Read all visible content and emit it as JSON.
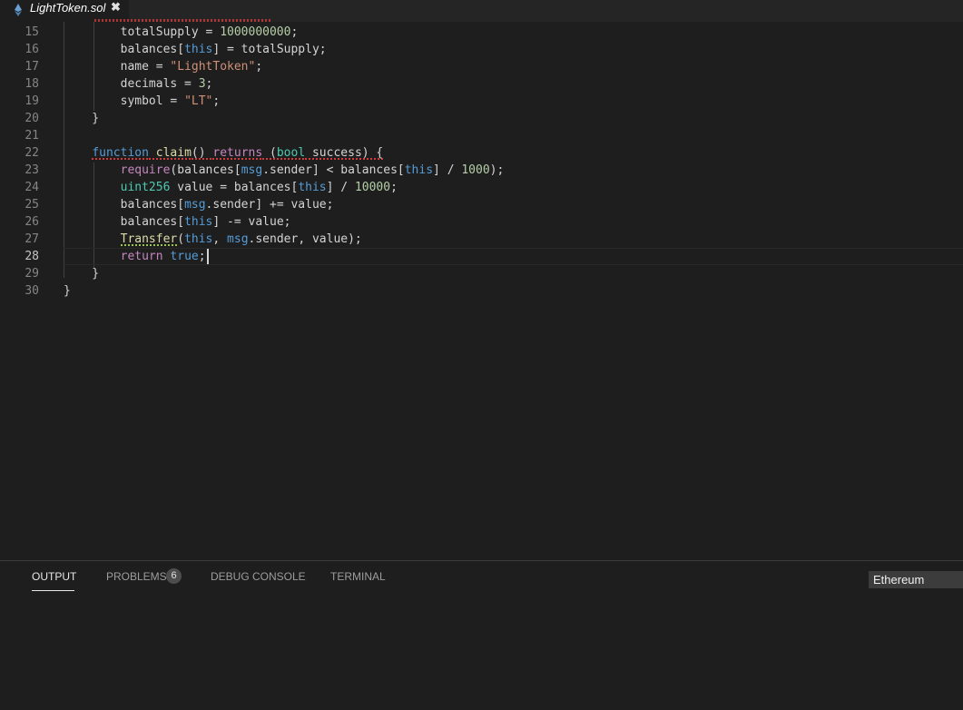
{
  "tab": {
    "title": "LightToken.sol",
    "icon": "ethereum-icon",
    "close_glyph": "✖"
  },
  "editor": {
    "active_line": "28",
    "lines": [
      {
        "num": "15",
        "tokens": [
          {
            "t": "        totalSupply = "
          },
          {
            "t": "1000000000",
            "c": "num"
          },
          {
            "t": ";"
          }
        ]
      },
      {
        "num": "16",
        "tokens": [
          {
            "t": "        balances["
          },
          {
            "t": "this",
            "c": "kw"
          },
          {
            "t": "] = totalSupply;"
          }
        ]
      },
      {
        "num": "17",
        "tokens": [
          {
            "t": "        name = "
          },
          {
            "t": "\"LightToken\"",
            "c": "str"
          },
          {
            "t": ";"
          }
        ]
      },
      {
        "num": "18",
        "tokens": [
          {
            "t": "        decimals = "
          },
          {
            "t": "3",
            "c": "num"
          },
          {
            "t": ";"
          }
        ]
      },
      {
        "num": "19",
        "tokens": [
          {
            "t": "        symbol = "
          },
          {
            "t": "\"LT\"",
            "c": "str"
          },
          {
            "t": ";"
          }
        ]
      },
      {
        "num": "20",
        "tokens": [
          {
            "t": "    }"
          }
        ]
      },
      {
        "num": "21",
        "tokens": []
      },
      {
        "num": "22",
        "tokens": [
          {
            "t": "    "
          },
          {
            "t": "function",
            "c": "kw err"
          },
          {
            "t": " ",
            "c": "err"
          },
          {
            "t": "claim",
            "c": "fn err"
          },
          {
            "t": "() ",
            "c": "err"
          },
          {
            "t": "returns",
            "c": "ctl err"
          },
          {
            "t": " (",
            "c": "err"
          },
          {
            "t": "bool",
            "c": "typ err"
          },
          {
            "t": " success) {",
            "c": "err"
          }
        ]
      },
      {
        "num": "23",
        "tokens": [
          {
            "t": "        "
          },
          {
            "t": "require",
            "c": "ctl"
          },
          {
            "t": "(balances["
          },
          {
            "t": "msg",
            "c": "kw"
          },
          {
            "t": ".sender] < balances["
          },
          {
            "t": "this",
            "c": "kw"
          },
          {
            "t": "] / "
          },
          {
            "t": "1000",
            "c": "num"
          },
          {
            "t": ");"
          }
        ]
      },
      {
        "num": "24",
        "tokens": [
          {
            "t": "        "
          },
          {
            "t": "uint256",
            "c": "typ"
          },
          {
            "t": " value = balances["
          },
          {
            "t": "this",
            "c": "kw"
          },
          {
            "t": "] / "
          },
          {
            "t": "10000",
            "c": "num"
          },
          {
            "t": ";"
          }
        ]
      },
      {
        "num": "25",
        "tokens": [
          {
            "t": "        balances["
          },
          {
            "t": "msg",
            "c": "kw"
          },
          {
            "t": ".sender] += value;"
          }
        ]
      },
      {
        "num": "26",
        "tokens": [
          {
            "t": "        balances["
          },
          {
            "t": "this",
            "c": "kw"
          },
          {
            "t": "] -= value;"
          }
        ]
      },
      {
        "num": "27",
        "tokens": [
          {
            "t": "        "
          },
          {
            "t": "Transfer",
            "c": "fn warn"
          },
          {
            "t": "("
          },
          {
            "t": "this",
            "c": "kw"
          },
          {
            "t": ", "
          },
          {
            "t": "msg",
            "c": "kw"
          },
          {
            "t": ".sender, value);"
          }
        ]
      },
      {
        "num": "28",
        "tokens": [
          {
            "t": "        "
          },
          {
            "t": "return",
            "c": "ctl"
          },
          {
            "t": " "
          },
          {
            "t": "true",
            "c": "kw"
          },
          {
            "t": ";"
          }
        ]
      },
      {
        "num": "29",
        "tokens": [
          {
            "t": "    }"
          }
        ]
      },
      {
        "num": "30",
        "tokens": [
          {
            "t": "}"
          }
        ]
      }
    ]
  },
  "panel": {
    "tabs": [
      "OUTPUT",
      "PROBLEMS",
      "DEBUG CONSOLE",
      "TERMINAL"
    ],
    "active_tab": "OUTPUT",
    "problems_count": "6",
    "output_channel": "Ethereum"
  },
  "colors": {
    "background": "#1e1e1e",
    "keyword": "#569cd6",
    "control": "#c586c0",
    "function": "#dcdcaa",
    "string": "#ce9178",
    "number": "#b5cea8",
    "type": "#4ec9b0",
    "error_squiggle": "#d23b3b",
    "warning_squiggle": "#9cc93b"
  }
}
